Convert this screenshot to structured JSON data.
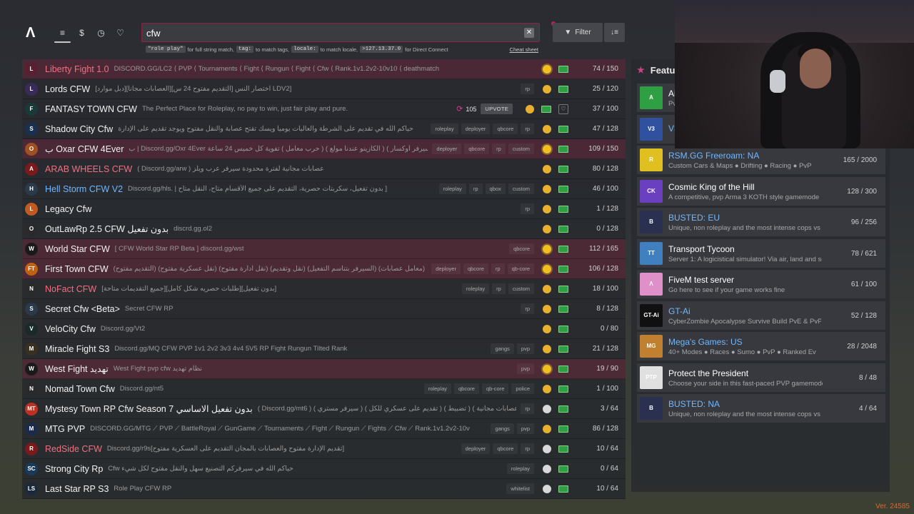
{
  "nav": {
    "logo": "Λ",
    "icons": [
      {
        "name": "list-icon",
        "glyph": "≡",
        "active": true
      },
      {
        "name": "dollar-icon",
        "glyph": "$",
        "active": false
      },
      {
        "name": "history-icon",
        "glyph": "◷",
        "active": false
      },
      {
        "name": "heart-icon",
        "glyph": "♡",
        "active": false
      }
    ]
  },
  "search": {
    "value": "cfw",
    "clear_icon": "✕",
    "hint": {
      "code1": "\"role play\"",
      "text1": "for full string match,",
      "code2": "tag:",
      "text2": "to match tags,",
      "code3": "locale:",
      "text3": "to match locale,",
      "code4": ">127.13.37.0",
      "text4": "for Direct Connect",
      "cheat": "Cheat sheet"
    }
  },
  "filter": {
    "icon": "▼",
    "label": "Filter",
    "sort_icon": "↓≡"
  },
  "servers": [
    {
      "name": "Liberty Fight 1.0",
      "color": "red",
      "premium": true,
      "icon": "L",
      "iconbg": "#5a2030",
      "desc": "DISCORD.GG/LC2 ⟨ PVP ⟨ Tournaments ⟨ Fight ⟨ Rungun ⟨ Fight ⟨ Cfw ⟨ Rank.1v1.2v2-10v10 ⟨ deathmatch",
      "tags": [],
      "time": "day",
      "players": "74 / 150"
    },
    {
      "name": "Lords CFW",
      "color": "",
      "premium": false,
      "icon": "L",
      "iconbg": "#3a2a5a",
      "desc": "[دبل موارد][العصابات مجانا][التقديم مفتوح 24 س] اختصار النس LDV2]",
      "tags": [
        "rp"
      ],
      "time": "eve",
      "players": "25 / 120"
    },
    {
      "name": "FANTASY TOWN CFW",
      "color": "",
      "premium": false,
      "icon": "F",
      "iconbg": "#1a3a3a",
      "desc": "The Perfect Place for Roleplay, no pay to win, just fair play and pure.",
      "tags": [],
      "boost": "105",
      "upvote": "UPVOTE",
      "heart": true,
      "time": "eve",
      "players": "37 / 100"
    },
    {
      "name": "Shadow City Cfw",
      "color": "",
      "premium": false,
      "icon": "S",
      "iconbg": "#1a3050",
      "desc": "حياكم الله في تقديم على الشرطة والعاليات يوميا ويسك تقتح عصابة والنقل مفتوح ويوجد تقديم على الإدارة",
      "tags": [
        "roleplay",
        "deployer",
        "qbcore",
        "rp"
      ],
      "time": "eve",
      "players": "47 / 128"
    },
    {
      "name": "ب Oxar CFW 4Ever",
      "color": "",
      "premium": true,
      "icon": "O",
      "iconbg": "#a05020",
      "desc": "ب | Discord.gg/Oxr 4Ever ٠+ ( سيرفر أوكسار ) ( الكازينو عندنا مولع ) ( حرب معامل ) تفوية كل خميس 24 ساعة",
      "tags": [
        "deployer",
        "qbcore",
        "rp",
        "custom"
      ],
      "time": "day",
      "players": "109 / 150"
    },
    {
      "name": "ARAB WHEELS CFW",
      "color": "red",
      "premium": false,
      "icon": "A",
      "iconbg": "#7a1a1a",
      "desc": "( Discord.gg/arw ) عصابات مجانية لفترة محدودة سيرفر عرب ويلز",
      "tags": [],
      "time": "eve",
      "players": "80 / 128"
    },
    {
      "name": "Hell Storm CFW V2",
      "color": "blue",
      "premium": false,
      "icon": "H",
      "iconbg": "#2a3a4a",
      "desc": "Discord.gg/hls. | بدون تفعيل، سكربتات حصرية، التقديم على جميع الأقسام متاح، النقل متاح ]",
      "tags": [
        "roleplay",
        "rp",
        "qbox",
        "custom"
      ],
      "time": "eve",
      "players": "46 / 100"
    },
    {
      "name": "Legacy Cfw",
      "color": "",
      "premium": false,
      "icon": "L",
      "iconbg": "#c05a20",
      "desc": "",
      "tags": [
        "rp"
      ],
      "time": "eve",
      "players": "1 / 128"
    },
    {
      "name": "OutLawRp 2.5 CFW بدون تفعيل",
      "color": "",
      "premium": false,
      "icon": "O",
      "iconbg": "#2a2a2a",
      "desc": "discrd.gg.ol2",
      "tags": [],
      "time": "eve",
      "players": "0 / 128"
    },
    {
      "name": "World Star CFW",
      "color": "",
      "premium": true,
      "icon": "W",
      "iconbg": "#1a1a1a",
      "desc": "[ CFW World Star RP Beta ] discord.gg/wst",
      "tags": [
        "qbcore"
      ],
      "time": "day",
      "players": "112 / 165"
    },
    {
      "name": "First Town CFW",
      "color": "",
      "premium": true,
      "icon": "FT",
      "iconbg": "#c06010",
      "desc": "(التقديم مفتوح) (نقل عسكرية مفتوح) (نقل ادارة مفتوح) (نقل وتقديم) (السيرفر بتناسم التفعيل) (معامل عصابات) (بكج عصابات مجانية) سيرية",
      "tags": [
        "deployer",
        "qbcore",
        "rp",
        "qb-core"
      ],
      "time": "day",
      "players": "106 / 128"
    },
    {
      "name": "NoFact CFW",
      "color": "red",
      "premium": false,
      "icon": "N",
      "iconbg": "#2a2a2a",
      "desc": "[جميع التقديمات متاحة][طلبات حصريه شكل كامل][بدون تفعيل]",
      "tags": [
        "roleplay",
        "rp",
        "custom"
      ],
      "time": "eve",
      "players": "18 / 100"
    },
    {
      "name": "Secret Cfw <Beta>",
      "color": "",
      "premium": false,
      "icon": "S",
      "iconbg": "#2a3a4a",
      "desc": "Secret CFW RP",
      "tags": [
        "rp"
      ],
      "time": "eve",
      "players": "8 / 128"
    },
    {
      "name": "VeloCity Cfw",
      "color": "",
      "premium": false,
      "icon": "V",
      "iconbg": "#1a2a2a",
      "desc": "Discord.gg/Vt2",
      "tags": [],
      "time": "eve",
      "players": "0 / 80"
    },
    {
      "name": "Miracle Fight S3",
      "color": "",
      "premium": false,
      "icon": "M",
      "iconbg": "#3a3020",
      "desc": "Discord.gg/MQ CFW PVP 1v1 2v2 3v3 4v4 5V5 RP Fight Rungun Tilted Rank",
      "tags": [
        "gangs",
        "pvp"
      ],
      "time": "eve",
      "players": "21 / 128"
    },
    {
      "name": "West Fight تهديد",
      "color": "",
      "premium": true,
      "icon": "W",
      "iconbg": "#1a1a1a",
      "desc": "West Fight pvp cfw نظام تهديد",
      "tags": [
        "pvp"
      ],
      "time": "day",
      "players": "19 / 90"
    },
    {
      "name": "Nomad Town Cfw",
      "color": "",
      "premium": false,
      "icon": "N",
      "iconbg": "#2a2a2a",
      "desc": "Discord.gg/nt5",
      "tags": [
        "roleplay",
        "qbcore",
        "qb-core",
        "police"
      ],
      "time": "eve",
      "players": "1 / 100"
    },
    {
      "name": "Mystesy Town RP Cfw Season 7 بدون تفعيل الاساسي",
      "color": "",
      "premium": false,
      "icon": "MT",
      "iconbg": "#c03020",
      "desc": "( Discord.gg/mt6 ) ( سيرفر مستري ) ( تقديم على عسكري للكل ) ( تضبيط ) ( عصابات مجانية ) ( تاتب مفتوح",
      "tags": [
        "rp"
      ],
      "time": "night",
      "players": "3 / 64"
    },
    {
      "name": "MTG PVP",
      "color": "",
      "premium": false,
      "icon": "M",
      "iconbg": "#1a2a4a",
      "desc": "DISCORD.GG/MTG ⟋ PVP ⟋ BattleRoyal ⟋ GunGame ⟋ Tournaments ⟋ Fight ⟋ Rungun ⟋ Fights ⟋ Cfw ⟋ Rank.1v1.2v2-10v",
      "tags": [
        "gangs",
        "pvp"
      ],
      "time": "eve",
      "players": "86 / 128"
    },
    {
      "name": "RedSide CFW",
      "color": "red",
      "premium": false,
      "icon": "R",
      "iconbg": "#7a1a1a",
      "desc": "Discord.gg/r9s[تقديم الإدارة مفتوح والعصابات بالمجان التقديم على العسكرية مفتوح]",
      "tags": [
        "deployer",
        "qbcore",
        "rp"
      ],
      "time": "night",
      "players": "10 / 64"
    },
    {
      "name": "Strong City Rp",
      "color": "",
      "premium": false,
      "icon": "SC",
      "iconbg": "#1a3a5a",
      "desc": "Cfw حياكم الله في سيرفركم التصنيع سهل والنقل مفتوح لكل شيء",
      "tags": [
        "roleplay"
      ],
      "time": "night",
      "players": "0 / 64"
    },
    {
      "name": "Last Star RP S3",
      "color": "",
      "premium": false,
      "icon": "LS",
      "iconbg": "#1a2a3a",
      "desc": "Role Play CFW RP",
      "tags": [
        "whitelist"
      ],
      "time": "night",
      "players": "10 / 64"
    }
  ],
  "featured": {
    "title": "Featu",
    "star": "★",
    "items": [
      {
        "title": "Ai",
        "sub": "Pv",
        "players": "",
        "color": "",
        "icon": "A",
        "iconbg": "#2ea043"
      },
      {
        "title": "V3",
        "sub": "",
        "players": "",
        "color": "blue",
        "icon": "V3",
        "iconbg": "#3050a0"
      },
      {
        "title": "RSM.GG Freeroam: NA",
        "sub": "Custom Cars & Maps ● Drifting ● Racing ● PvP",
        "players": "165 / 2000",
        "color": "blue",
        "icon": "R",
        "iconbg": "#e0c020"
      },
      {
        "title": "Cosmic King of the Hill",
        "sub": "A competitive, pvp Arma 3 KOTH style gamemode",
        "players": "128 / 300",
        "color": "",
        "icon": "CK",
        "iconbg": "#6a40c0"
      },
      {
        "title": "BUSTED: EU",
        "sub": "Unique, non roleplay and the most intense cops vs",
        "players": "96 / 256",
        "color": "blue",
        "icon": "B",
        "iconbg": "#2a3050"
      },
      {
        "title": "Transport Tycoon",
        "sub": "Server 1: A logicistical simulator! Via air, land and se",
        "players": "78 / 621",
        "color": "",
        "icon": "TT",
        "iconbg": "#4080c0"
      },
      {
        "title": "FiveM test server",
        "sub": "Go here to see if your game works fine",
        "players": "61 / 100",
        "color": "",
        "icon": "Λ",
        "iconbg": "#e090c8"
      },
      {
        "title": "GT-Ai",
        "sub": "CyberZombie Apocalypse Survive Build PvE & PvP",
        "players": "52 / 128",
        "color": "blue",
        "icon": "GT-Ai",
        "iconbg": "#101010"
      },
      {
        "title": "Mega's Games: US",
        "sub": "40+ Modes ● Races ● Sumo ● PvP ● Ranked Ev",
        "players": "28 / 2048",
        "color": "blue",
        "icon": "MG",
        "iconbg": "#c08030"
      },
      {
        "title": "Protect the President",
        "sub": "Choose your side in this fast-paced PVP gamemode",
        "players": "8 / 48",
        "color": "",
        "icon": "PTP",
        "iconbg": "#e0e0e0"
      },
      {
        "title": "BUSTED: NA",
        "sub": "Unique, non roleplay and the most intense cops vs r",
        "players": "4 / 64",
        "color": "blue",
        "icon": "B",
        "iconbg": "#2a3050"
      }
    ]
  },
  "version": "Ver. 24585"
}
